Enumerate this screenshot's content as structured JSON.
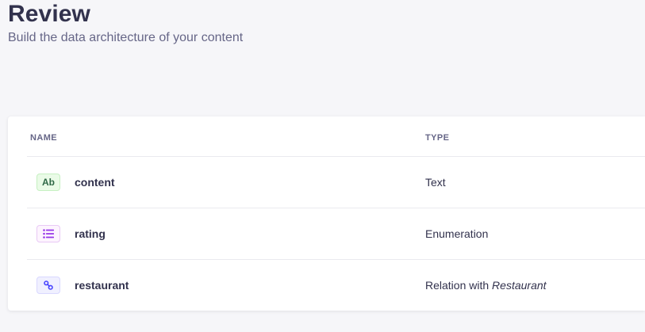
{
  "header": {
    "title": "Review",
    "subtitle": "Build the data architecture of your content"
  },
  "table": {
    "columns": {
      "name": "NAME",
      "type": "TYPE"
    },
    "rows": [
      {
        "icon": "text-field-icon",
        "icon_label": "Ab",
        "name": "content",
        "type": "Text",
        "type_target": ""
      },
      {
        "icon": "enumeration-list-icon",
        "name": "rating",
        "type": "Enumeration",
        "type_target": ""
      },
      {
        "icon": "relation-link-icon",
        "name": "restaurant",
        "type": "Relation with ",
        "type_target": "Restaurant"
      }
    ]
  },
  "colors": {
    "background": "#f6f6f9",
    "text_icon_bg": "#eafbe7",
    "text_icon_fg": "#2f6846",
    "enum_icon_fg": "#9736e8",
    "relation_icon_fg": "#4945ff"
  }
}
